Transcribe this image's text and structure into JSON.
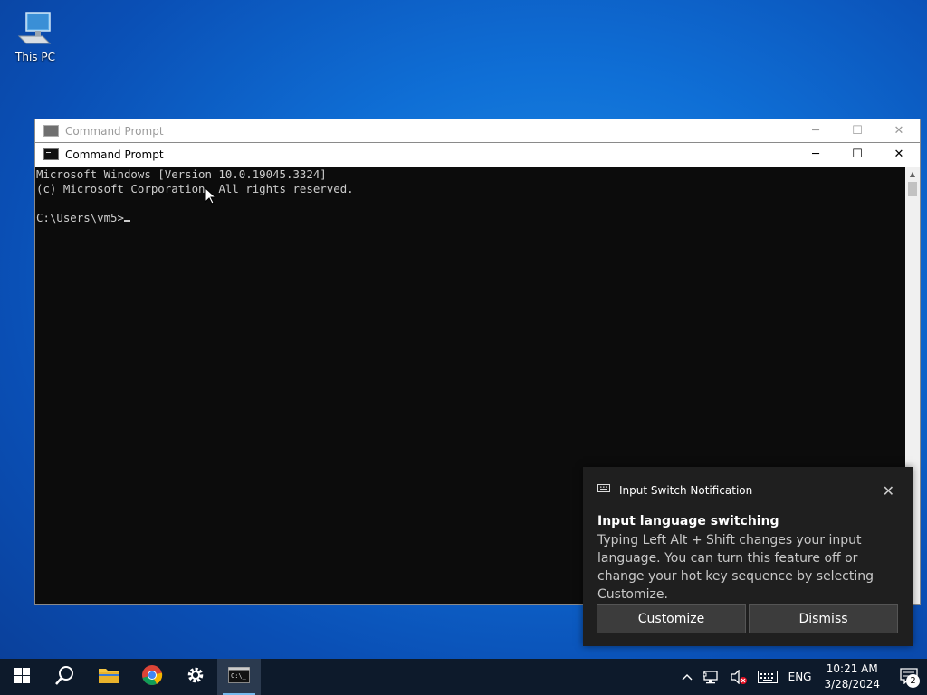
{
  "desktop": {
    "this_pc_label": "This PC"
  },
  "back_window": {
    "title": "Command Prompt"
  },
  "cmd_window": {
    "title": "Command Prompt",
    "console_lines": [
      "Microsoft Windows [Version 10.0.19045.3324]",
      "(c) Microsoft Corporation. All rights reserved.",
      "",
      "C:\\Users\\vm5>"
    ]
  },
  "notification": {
    "header": "Input Switch Notification",
    "title": "Input language switching",
    "body": "Typing Left Alt + Shift changes your input language. You can turn this feature off or change your hot key sequence by selecting Customize.",
    "customize_label": "Customize",
    "dismiss_label": "Dismiss"
  },
  "taskbar": {
    "language": "ENG",
    "time": "10:21 AM",
    "date": "3/28/2024",
    "notification_count": "2",
    "accent": "#76b9ed"
  }
}
